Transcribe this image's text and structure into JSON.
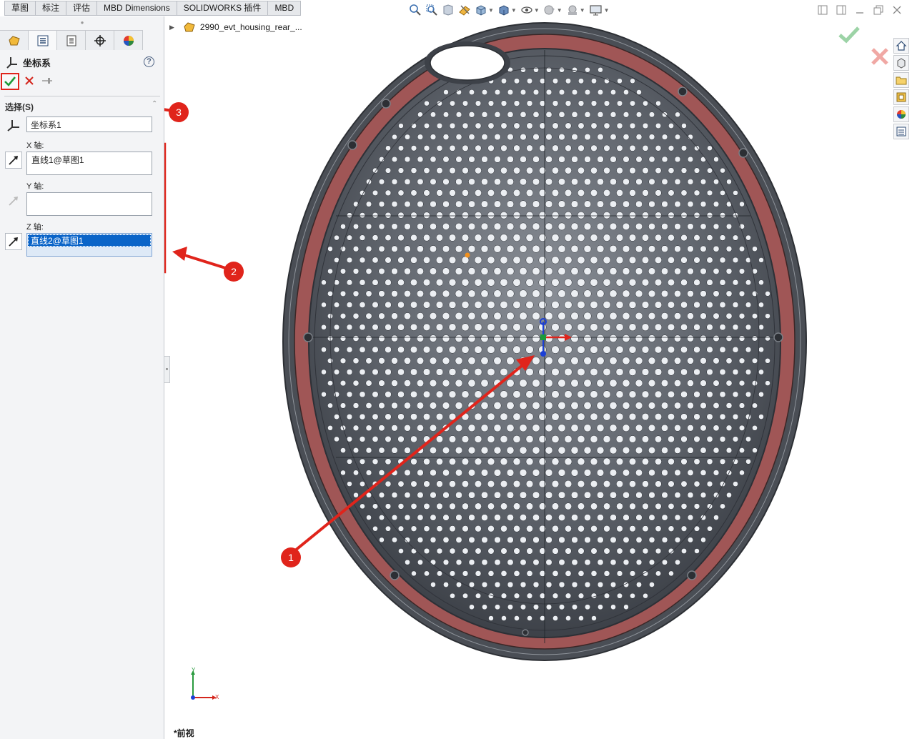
{
  "tabs": [
    "草图",
    "标注",
    "评估",
    "MBD Dimensions",
    "SOLIDWORKS 插件",
    "MBD"
  ],
  "property_manager": {
    "title": "坐标系",
    "help_symbol": "?",
    "section_title": "选择(S)",
    "coord_name": "坐标系1",
    "x_axis_label": "X 轴:",
    "x_axis_value": "直线1@草图1",
    "y_axis_label": "Y 轴:",
    "y_axis_value": "",
    "z_axis_label": "Z 轴:",
    "z_axis_value": "直线2@草图1"
  },
  "feature_tree": {
    "root_label": "2990_evt_housing_rear_..."
  },
  "viewport": {
    "view_name": "*前视",
    "triad_x": "X",
    "triad_y": "Y"
  },
  "annotations": {
    "markers": [
      "1",
      "2",
      "3"
    ],
    "arrow_color": "#e0241b"
  },
  "model": {
    "shell_color": "#3d4148",
    "gasket_color": "#a05656",
    "hole_color": "#eceff3"
  },
  "icons": {
    "hud": [
      "zoom-to-fit-icon",
      "zoom-area-icon",
      "previous-view-icon",
      "section-view-icon",
      "view-orientation-icon",
      "display-style-icon",
      "hide-show-icon",
      "edit-appearance-icon",
      "scene-icon",
      "view-settings-icon"
    ],
    "taskpane": [
      "home-icon",
      "design-library-icon",
      "file-explorer-icon",
      "view-palette-icon",
      "appearances-icon",
      "custom-properties-icon"
    ],
    "panel_tabs": [
      "feature-manager-icon",
      "property-manager-icon",
      "configuration-manager-icon",
      "dimxpert-icon",
      "display-manager-icon"
    ]
  }
}
